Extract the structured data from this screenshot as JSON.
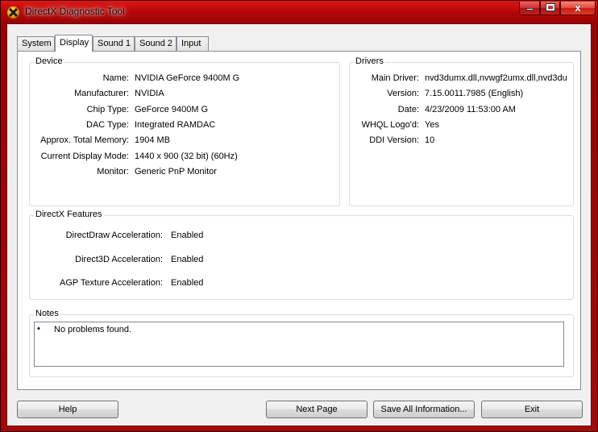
{
  "window": {
    "title": "DirectX Diagnostic Tool",
    "controls": {
      "minimize": "",
      "maximize": "",
      "close": "x"
    }
  },
  "tabs": [
    {
      "label": "System",
      "active": false
    },
    {
      "label": "Display",
      "active": true
    },
    {
      "label": "Sound 1",
      "active": false
    },
    {
      "label": "Sound 2",
      "active": false
    },
    {
      "label": "Input",
      "active": false
    }
  ],
  "device": {
    "title": "Device",
    "rows": [
      {
        "label": "Name:",
        "value": "NVIDIA GeForce 9400M G"
      },
      {
        "label": "Manufacturer:",
        "value": "NVIDIA"
      },
      {
        "label": "Chip Type:",
        "value": "GeForce 9400M G"
      },
      {
        "label": "DAC Type:",
        "value": "Integrated RAMDAC"
      },
      {
        "label": "Approx. Total Memory:",
        "value": "1904 MB"
      },
      {
        "label": "Current Display Mode:",
        "value": "1440 x 900 (32 bit) (60Hz)"
      },
      {
        "label": "Monitor:",
        "value": "Generic PnP Monitor"
      }
    ]
  },
  "drivers": {
    "title": "Drivers",
    "rows": [
      {
        "label": "Main Driver:",
        "value": "nvd3dumx.dll,nvwgf2umx.dll,nvd3du"
      },
      {
        "label": "Version:",
        "value": "7.15.0011.7985 (English)"
      },
      {
        "label": "Date:",
        "value": "4/23/2009 11:53:00 AM"
      },
      {
        "label": "WHQL Logo'd:",
        "value": "Yes"
      },
      {
        "label": "DDI Version:",
        "value": "10"
      }
    ]
  },
  "features": {
    "title": "DirectX Features",
    "rows": [
      {
        "label": "DirectDraw Acceleration:",
        "value": "Enabled"
      },
      {
        "label": "Direct3D Acceleration:",
        "value": "Enabled"
      },
      {
        "label": "AGP Texture Acceleration:",
        "value": "Enabled"
      }
    ]
  },
  "notes": {
    "title": "Notes",
    "bullet": "•",
    "items": [
      "No problems found."
    ]
  },
  "buttons": {
    "help": "Help",
    "next_page": "Next Page",
    "save_all": "Save All Information...",
    "exit": "Exit"
  }
}
